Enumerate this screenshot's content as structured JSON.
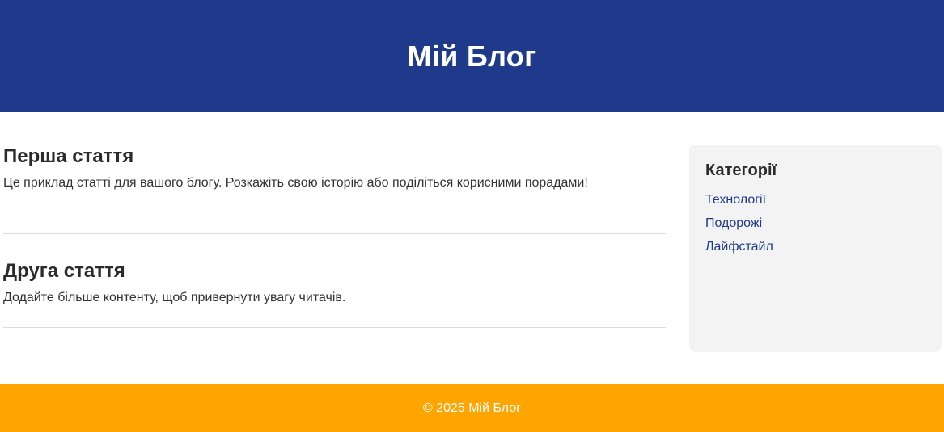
{
  "header": {
    "title": "Мій Блог"
  },
  "articles": [
    {
      "title": "Перша стаття",
      "text": "Це приклад статті для вашого блогу. Розкажіть свою історію або поділіться корисними порадами!"
    },
    {
      "title": "Друга стаття",
      "text": "Додайте більше контенту, щоб привернути увагу читачів."
    }
  ],
  "sidebar": {
    "title": "Категорії",
    "categories": [
      {
        "label": "Технології"
      },
      {
        "label": "Подорожі"
      },
      {
        "label": "Лайфстайл"
      }
    ]
  },
  "footer": {
    "text": "© 2025 Мій Блог"
  },
  "colors": {
    "header_bg": "#1f3a8a",
    "footer_bg": "#ffa500",
    "sidebar_bg": "#f3f3f3",
    "link": "#1f3a8a"
  }
}
